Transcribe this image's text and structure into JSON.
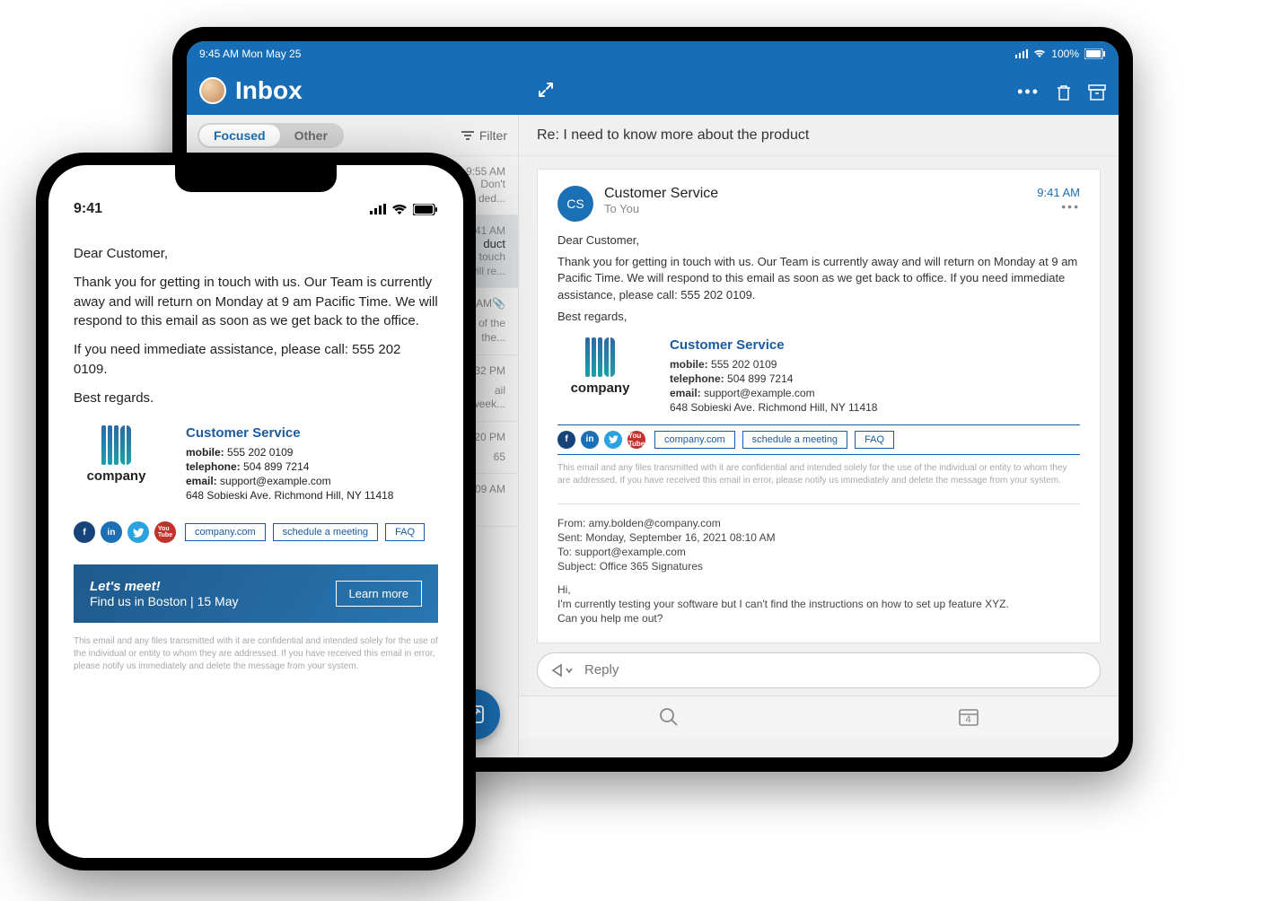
{
  "tablet": {
    "status": {
      "time_date": "9:45 AM Mon May 25",
      "battery": "100%"
    },
    "header": {
      "title": "Inbox"
    },
    "list": {
      "tab_focused": "Focused",
      "tab_other": "Other",
      "filter_label": "Filter",
      "items": [
        {
          "time": "9:55 AM",
          "preview1": "Don't",
          "preview2": "ded..."
        },
        {
          "time": "9:41 AM",
          "subject": "duct",
          "preview1": "n touch",
          "preview2": "will re..."
        },
        {
          "time": "1:39 AM",
          "preview1": "of the",
          "preview2": "the..."
        },
        {
          "time": "3:32 PM",
          "preview1": "ail",
          "preview2": "week..."
        },
        {
          "time": "5:20 PM",
          "preview1": "65"
        },
        {
          "time": "0:09 AM"
        }
      ]
    },
    "subject": "Re: I need to know more about the product",
    "mail": {
      "avatar": "CS",
      "from": "Customer Service",
      "to": "To You",
      "time": "9:41 AM",
      "greeting": "Dear Customer,",
      "para": "Thank you for getting in touch with us. Our Team is currently away and will return on Monday at 9 am Pacific Time. We will respond to this email as soon as we get back to office. If you need immediate assistance, please call: 555 202 0109.",
      "signoff": "Best regards,"
    },
    "sig": {
      "logo_text": "company",
      "name": "Customer Service",
      "mobile_label": "mobile:",
      "mobile": "555 202 0109",
      "phone_label": "telephone:",
      "phone": "504 899 7214",
      "email_label": "email:",
      "email": "support@example.com",
      "address": "648 Sobieski Ave. Richmond Hill, NY 11418",
      "btn_site": "company.com",
      "btn_meeting": "schedule a meeting",
      "btn_faq": "FAQ",
      "disclaimer": "This email and any files transmitted with it are confidential and intended solely for the use of the individual or entity to whom they are addressed. If you have received this email in error, please notify us immediately and delete the message from your system."
    },
    "quoted": {
      "from": "From: amy.bolden@company.com",
      "sent": "Sent: Monday, September 16, 2021 08:10 AM",
      "to": "To: support@example.com",
      "subject": "Subject: Office 365 Signatures",
      "hi": "Hi,",
      "line1": "I'm currently testing your software but I can't find the instructions on how to set up feature XYZ.",
      "line2": "Can you help me out?"
    },
    "reply_placeholder": "Reply",
    "footer_badge": "4"
  },
  "phone": {
    "time": "9:41",
    "greeting": "Dear Customer,",
    "para1": "Thank you for getting in touch with us. Our Team is currently away and will return on Monday at 9 am Pacific Time. We will respond to this email as soon as we get back to the office.",
    "para2": "If you need immediate assistance, please call: 555 202 0109.",
    "signoff": "Best regards.",
    "sig": {
      "logo_text": "company",
      "name": "Customer Service",
      "mobile_label": "mobile:",
      "mobile": "555 202 0109",
      "phone_label": "telephone:",
      "phone": "504 899 7214",
      "email_label": "email:",
      "email": "support@example.com",
      "address": "648 Sobieski Ave. Richmond Hill, NY 11418",
      "btn_site": "company.com",
      "btn_meeting": "schedule a meeting",
      "btn_faq": "FAQ"
    },
    "banner": {
      "title": "Let's meet!",
      "subtitle": "Find us in Boston | 15 May",
      "cta": "Learn more"
    },
    "disclaimer": "This email and any files transmitted with it are confidential and intended solely for the use of the individual or entity to whom they are addressed. If you have received this email in error, please notify us immediately and delete the message from your system."
  }
}
